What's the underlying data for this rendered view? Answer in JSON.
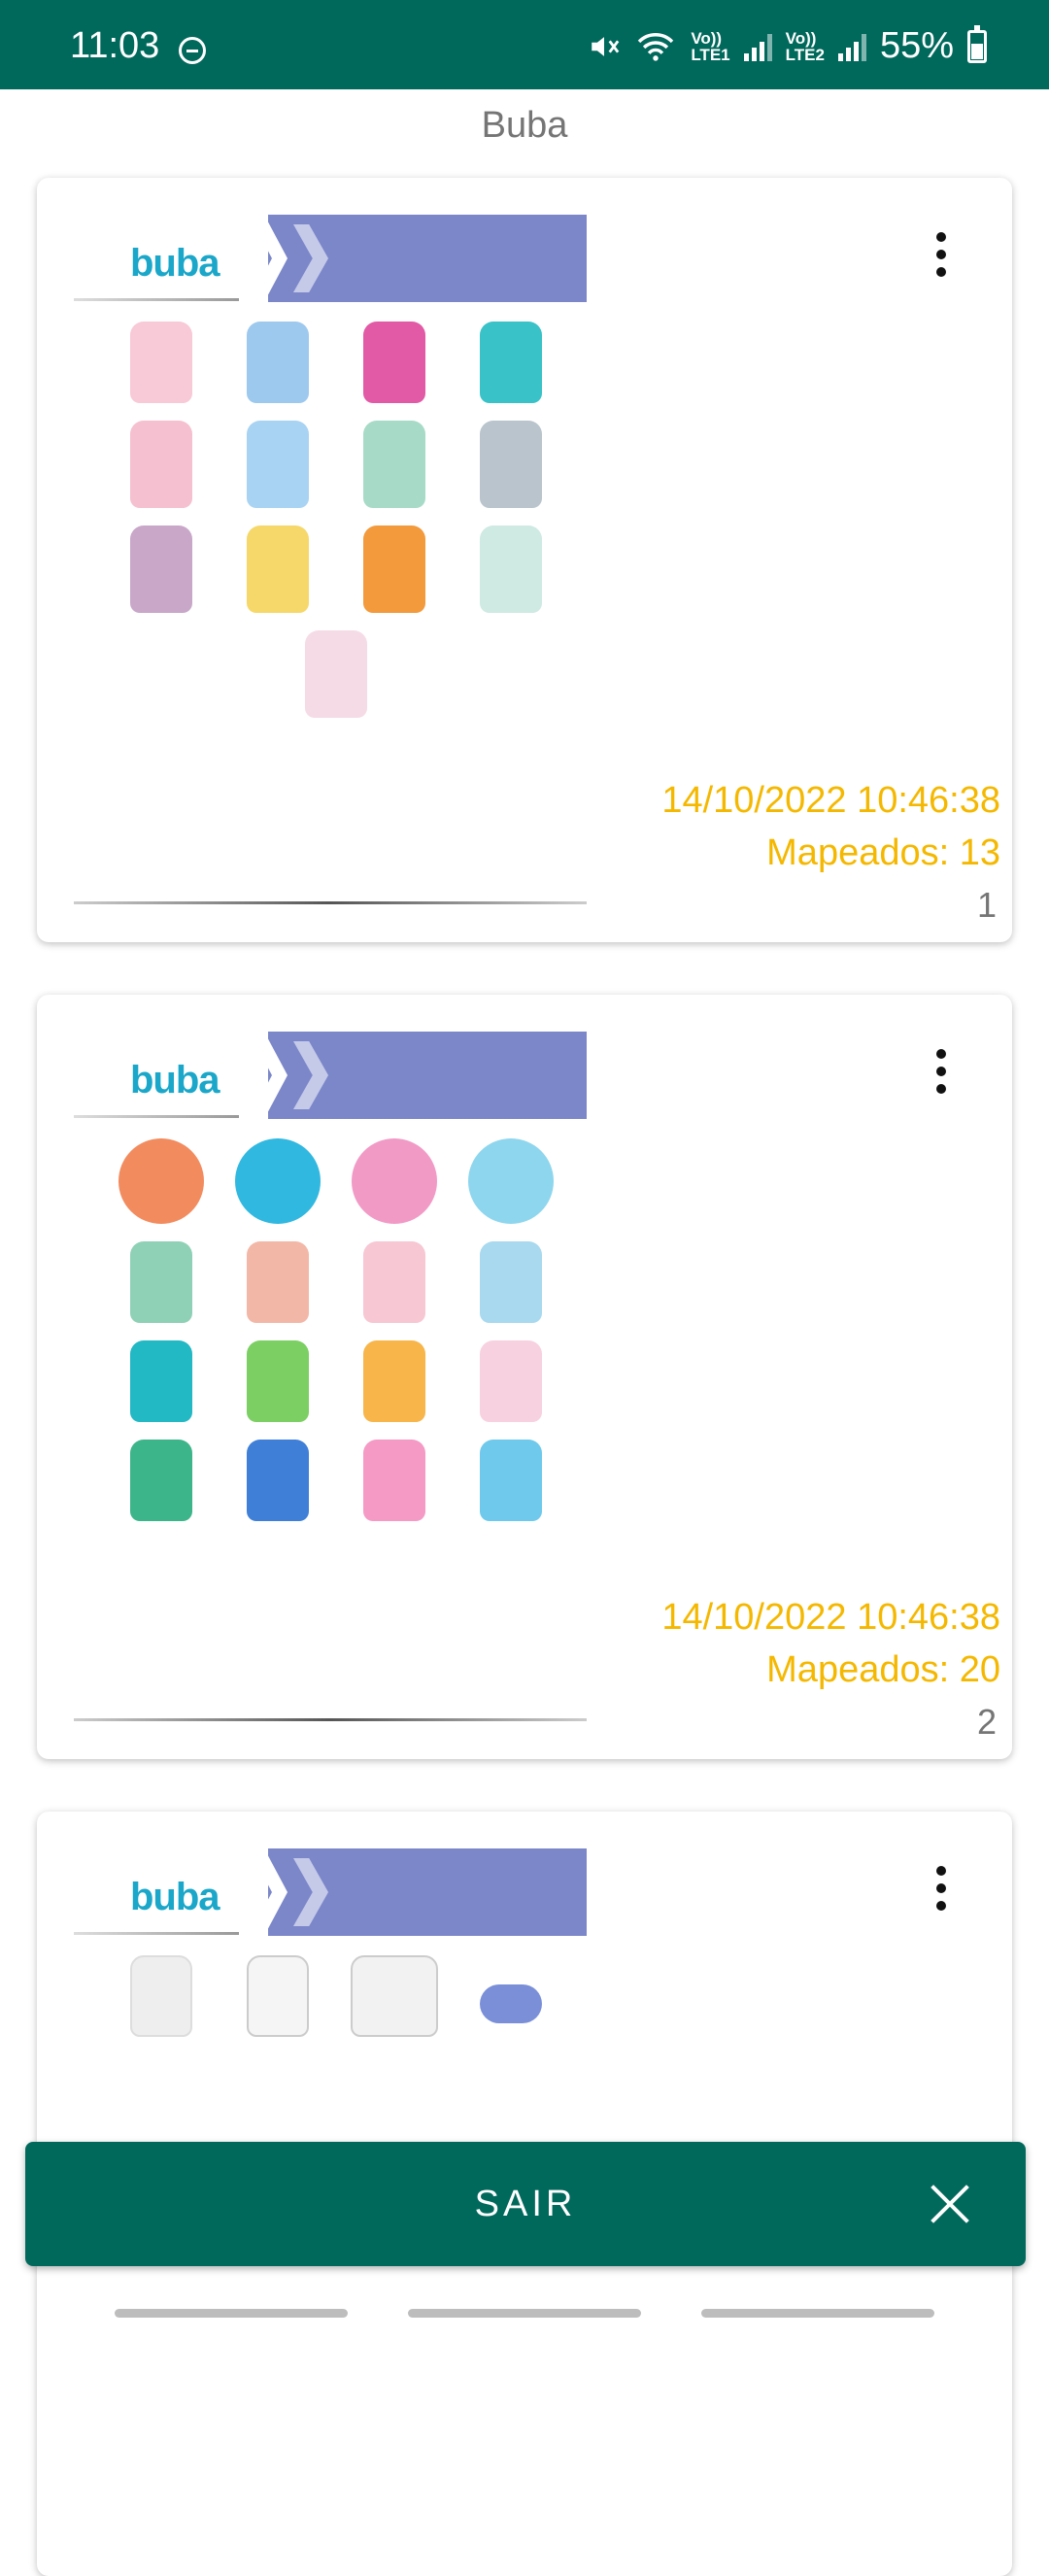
{
  "status_bar": {
    "time": "11:03",
    "net1": [
      "Vo))",
      "LTE1"
    ],
    "net2": [
      "Vo))",
      "LTE2"
    ],
    "battery": "55%",
    "icons": [
      "dnd-icon",
      "mute-icon",
      "wifi-icon",
      "signal-icon",
      "battery-icon"
    ]
  },
  "header": {
    "title": "Buba"
  },
  "cards": [
    {
      "date": "14/10/2022 10:46:38",
      "mapped": "Mapeados: 13",
      "index": "1",
      "logo": "buba"
    },
    {
      "date": "14/10/2022 10:46:38",
      "mapped": "Mapeados: 20",
      "index": "2",
      "logo": "buba"
    },
    {
      "date": "",
      "mapped": "",
      "index": "",
      "logo": "buba"
    }
  ],
  "footer": {
    "exit_label": "SAIR"
  },
  "colors": {
    "primary": "#00695c",
    "accent": "#f5b800",
    "muted": "#757575"
  }
}
